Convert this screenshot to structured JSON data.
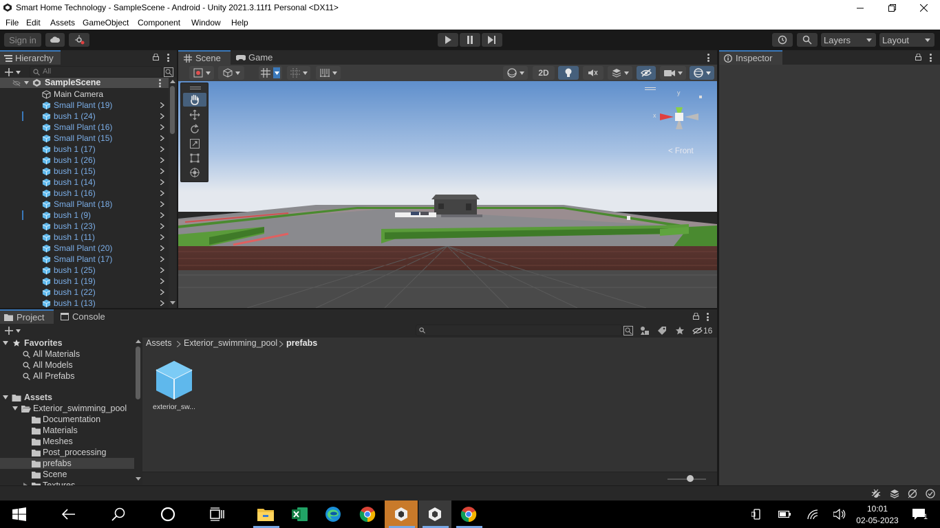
{
  "window": {
    "title": "Smart Home Technology - SampleScene - Android - Unity 2021.3.11f1 Personal <DX11>"
  },
  "menu": [
    "File",
    "Edit",
    "Assets",
    "GameObject",
    "Component",
    "Window",
    "Help"
  ],
  "toolbar": {
    "sign_in": "Sign in",
    "layers": "Layers",
    "layout": "Layout"
  },
  "hierarchy": {
    "tab": "Hierarchy",
    "search_placeholder": "All",
    "scene_name": "SampleScene",
    "items": [
      "Main Camera",
      "Small Plant (19)",
      "bush 1 (24)",
      "Small Plant (16)",
      "Small Plant (15)",
      "bush 1 (17)",
      "bush 1 (26)",
      "bush 1 (15)",
      "bush 1 (14)",
      "bush 1 (16)",
      "Small Plant (18)",
      "bush 1 (9)",
      "bush 1 (23)",
      "bush 1 (11)",
      "Small Plant (20)",
      "Small Plant (17)",
      "bush 1 (25)",
      "bush 1 (19)",
      "bush 1 (22)",
      "bush 1 (13)"
    ]
  },
  "scene": {
    "tab_scene": "Scene",
    "tab_game": "Game",
    "btn_2d": "2D",
    "gizmo_label": "< Front",
    "axis_x": "x",
    "axis_y": "y"
  },
  "inspector": {
    "tab": "Inspector"
  },
  "project": {
    "tab_project": "Project",
    "tab_console": "Console",
    "hidden_count": "16",
    "favorites_label": "Favorites",
    "favorites": [
      "All Materials",
      "All Models",
      "All Prefabs"
    ],
    "assets_label": "Assets",
    "folder_root": "Exterior_swimming_pool",
    "subfolders": [
      "Documentation",
      "Materials",
      "Meshes",
      "Post_processing",
      "prefabs",
      "Scene",
      "Textures"
    ],
    "breadcrumb": [
      "Assets",
      "Exterior_swimming_pool",
      "prefabs"
    ],
    "asset_name": "exterior_sw..."
  },
  "taskbar": {
    "time": "10:01",
    "date": "02-05-2023",
    "notification_count": "1"
  },
  "colors": {
    "accent": "#3a79bb",
    "hierarchy_link": "#7baee8",
    "panel_bg": "#282828",
    "cube_blue": "#5fb8ec"
  }
}
